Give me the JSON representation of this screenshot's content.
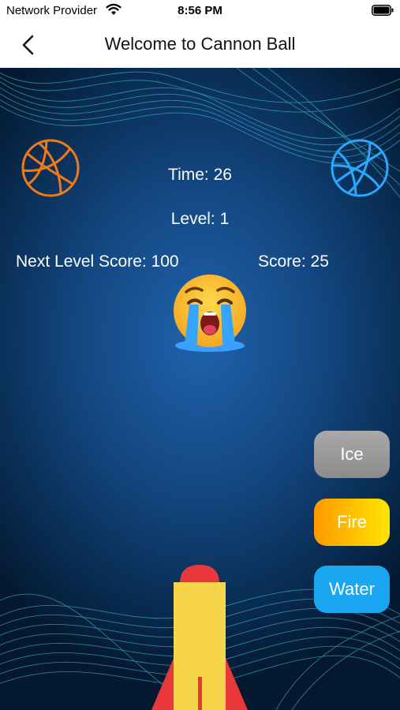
{
  "status_bar": {
    "carrier": "Network Provider",
    "time": "8:56 PM",
    "wifi_icon": "wifi-icon",
    "battery_icon": "battery-icon"
  },
  "nav": {
    "title": "Welcome to Cannon Ball",
    "back_icon": "chevron-left-icon"
  },
  "hud": {
    "time": "Time: 26",
    "level": "Level: 1",
    "next_level_score": "Next Level Score: 100",
    "score": "Score: 25"
  },
  "balls": [
    {
      "name": "basketball-icon",
      "color": "#f07a1a"
    },
    {
      "name": "basketball-icon",
      "color": "#2aa8ff"
    }
  ],
  "status_emoji": "crying-face-emoji",
  "powerups": [
    {
      "label": "Ice"
    },
    {
      "label": "Fire"
    },
    {
      "label": "Water"
    }
  ],
  "cannon": "rocket-cannon",
  "colors": {
    "background": "#13467f",
    "ice": "#999999",
    "fire": "#ffb000",
    "water": "#1aa6f0"
  }
}
